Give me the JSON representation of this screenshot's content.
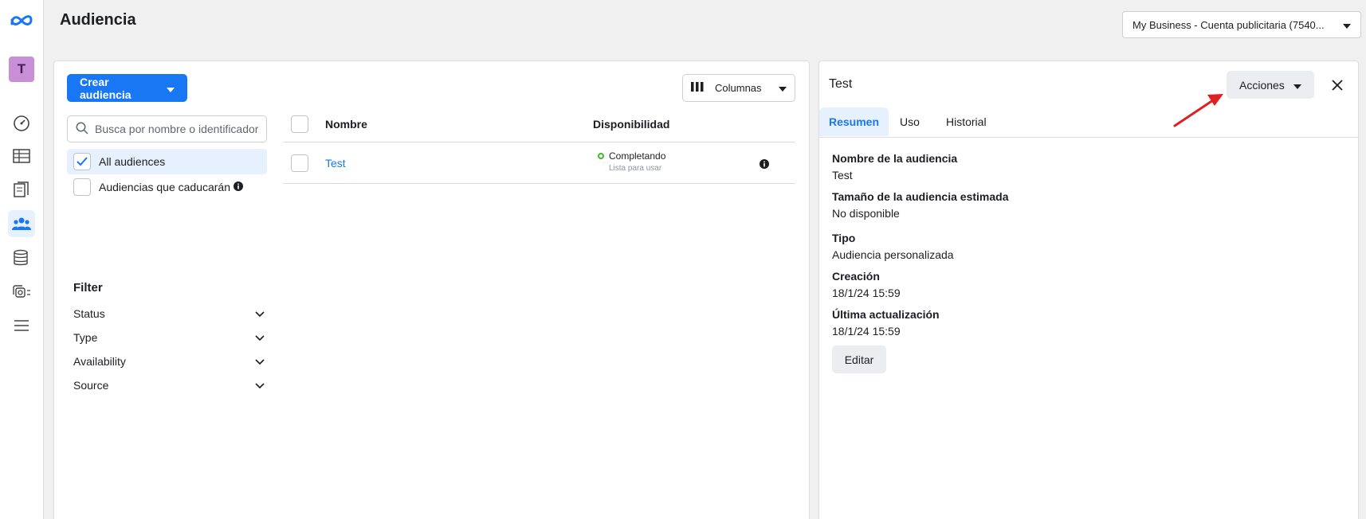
{
  "page": {
    "title": "Audiencia"
  },
  "account": {
    "label": "My Business - Cuenta publicitaria (7540..."
  },
  "rail": {
    "avatar_letter": "T",
    "icons": [
      "meta-logo-icon",
      "dashboard-icon",
      "table-icon",
      "pages-icon",
      "audiences-icon",
      "catalog-icon",
      "media-icon",
      "menu-icon"
    ]
  },
  "main": {
    "create_button": "Crear audiencia",
    "columns_button": "Columnas",
    "search": {
      "placeholder": "Busca por nombre o identificador",
      "value": ""
    },
    "audience_options": [
      {
        "label": "All audiences",
        "checked": true
      },
      {
        "label": "Audiencias que caducarán",
        "checked": false
      }
    ],
    "filter": {
      "heading": "Filter",
      "items": [
        "Status",
        "Type",
        "Availability",
        "Source"
      ]
    },
    "table": {
      "headers": {
        "name": "Nombre",
        "availability": "Disponibilidad"
      },
      "rows": [
        {
          "name": "Test",
          "status": "Completando",
          "status_sub": "Lista para usar"
        }
      ]
    }
  },
  "detail": {
    "title": "Test",
    "actions_button": "Acciones",
    "tabs": [
      "Resumen",
      "Uso",
      "Historial"
    ],
    "active_tab": "Resumen",
    "fields": [
      {
        "label": "Nombre de la audiencia",
        "value": "Test"
      },
      {
        "label": "Tamaño de la audiencia estimada",
        "value": "No disponible"
      },
      {
        "label": "Tipo",
        "value": "Audiencia personalizada"
      },
      {
        "label": "Creación",
        "value": "18/1/24 15:59"
      },
      {
        "label": "Última actualización",
        "value": "18/1/24 15:59"
      }
    ],
    "edit_button": "Editar"
  },
  "colors": {
    "primary": "#1877f2",
    "status_green": "#42b72a",
    "annotation_arrow": "#e02020",
    "avatar_bg": "#c98fd6"
  }
}
